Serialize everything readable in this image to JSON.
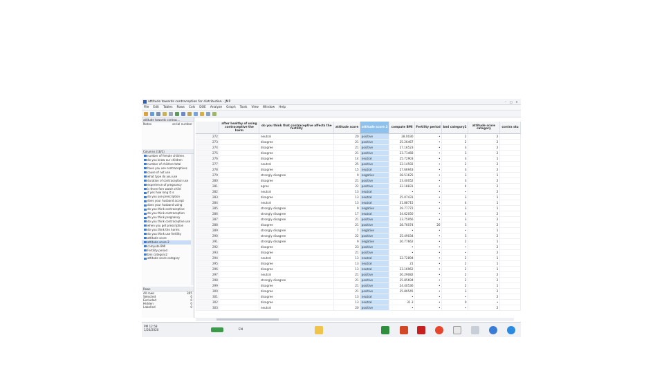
{
  "window": {
    "title": "attitude towards contraception for distribution - JMP"
  },
  "menu": [
    "File",
    "Edit",
    "Tables",
    "Rows",
    "Cols",
    "DOE",
    "Analyze",
    "Graph",
    "Tools",
    "View",
    "Window",
    "Help"
  ],
  "table_pane": {
    "name": "attitude towards contrac...",
    "notes_label": "Notes",
    "notes_value": "serial number"
  },
  "columns_pane": {
    "header": "Columns (18/1)",
    "items": [
      "number of female children",
      "do you know our children",
      "number of children total",
      "have you use contraceptives",
      "cause of not use",
      "what type do you use",
      "duration of contraception use",
      "experience of pregnancy",
      "is there fore watch child",
      "if yes how long it is",
      "do you use prescription",
      "does your husband accept",
      "does your husband using",
      "do you think contraceptive",
      "do you think contraception",
      "do you think pregnancy",
      "do you think contraceptive use",
      "when you get prescription",
      "do you think the harms",
      "do you think use fertility",
      "attitude score",
      "attitude score 2",
      "compute BMI",
      "Fertility period",
      "bmi category2",
      "attitude score category"
    ],
    "selected_index": 21
  },
  "rows_pane": {
    "header": "Rows",
    "stats": [
      {
        "label": "All rows",
        "value": "305"
      },
      {
        "label": "Selected",
        "value": "0"
      },
      {
        "label": "Excluded",
        "value": "0"
      },
      {
        "label": "Hidden",
        "value": "0"
      },
      {
        "label": "Labelled",
        "value": "0"
      }
    ]
  },
  "grid": {
    "headers": [
      "",
      "after healthy of using contraceptive the harm",
      "do you think that contraceptive affects the fertility",
      "attitude score",
      "attitude score 2",
      "compute BMI",
      "Fertility period",
      "bmi category2",
      "attitude score category",
      "contra stu"
    ],
    "rows": [
      [
        "272",
        "",
        "neutral",
        "20",
        "positive",
        "28.0030",
        "•",
        "2",
        "2",
        ""
      ],
      [
        "273",
        "",
        "disagree",
        "21",
        "positive",
        "25.26467",
        "•",
        "2",
        "2",
        ""
      ],
      [
        "274",
        "",
        "disagree",
        "21",
        "positive",
        "27.16523",
        "•",
        "3",
        "2",
        ""
      ],
      [
        "275",
        "",
        "disagree",
        "21",
        "positive",
        "23.71468",
        "•",
        "3",
        "2",
        ""
      ],
      [
        "276",
        "",
        "disagree",
        "14",
        "neutral",
        "25.72903",
        "•",
        "3",
        "1",
        ""
      ],
      [
        "277",
        "",
        "neutral",
        "25",
        "positive",
        "22.14592",
        "•",
        "2",
        "2",
        ""
      ],
      [
        "278",
        "",
        "disagree",
        "15",
        "neutral",
        "27.66943",
        "•",
        "3",
        "2",
        ""
      ],
      [
        "279",
        "",
        "strongly disagree",
        "9",
        "negative",
        "28.51625",
        "•",
        "3",
        "1",
        ""
      ],
      [
        "280",
        "",
        "disagree",
        "21",
        "positive",
        "23.40052",
        "•",
        "3",
        "2",
        ""
      ],
      [
        "281",
        "",
        "agree",
        "22",
        "positive",
        "32.18831",
        "•",
        "4",
        "2",
        ""
      ],
      [
        "282",
        "",
        "neutral",
        "13",
        "neutral",
        "•",
        "•",
        "•",
        "2",
        ""
      ],
      [
        "283",
        "",
        "disagree",
        "13",
        "neutral",
        "25.07431",
        "•",
        "3",
        "1",
        ""
      ],
      [
        "284",
        "",
        "neutral",
        "13",
        "neutral",
        "31.88715",
        "•",
        "4",
        "1",
        ""
      ],
      [
        "285",
        "",
        "strongly disagree",
        "9",
        "negative",
        "29.77772",
        "•",
        "3",
        "1",
        ""
      ],
      [
        "286",
        "",
        "strongly disagree",
        "17",
        "neutral",
        "34.62050",
        "•",
        "4",
        "2",
        ""
      ],
      [
        "287",
        "",
        "strongly disagree",
        "21",
        "positive",
        "23.75956",
        "•",
        "3",
        "2",
        ""
      ],
      [
        "288",
        "",
        "disagree",
        "21",
        "positive",
        "28.76074",
        "26",
        "3",
        "2",
        ""
      ],
      [
        "289",
        "",
        "strongly disagree",
        "7",
        "negative",
        "•",
        "•",
        "•",
        "1",
        ""
      ],
      [
        "290",
        "",
        "strongly disagree",
        "22",
        "positive",
        "25.49034",
        "•",
        "3",
        "2",
        ""
      ],
      [
        "291",
        "",
        "strongly disagree",
        "9",
        "negative",
        "20.77662",
        "•",
        "2",
        "1",
        ""
      ],
      [
        "292",
        "",
        "disagree",
        "23",
        "positive",
        "•",
        "•",
        "•",
        "2",
        ""
      ],
      [
        "293",
        "",
        "disagree",
        "21",
        "positive",
        "•",
        "•",
        "•",
        "2",
        ""
      ],
      [
        "294",
        "",
        "neutral",
        "13",
        "neutral",
        "22.72894",
        "•",
        "2",
        "1",
        ""
      ],
      [
        "295",
        "",
        "disagree",
        "13",
        "neutral",
        "21",
        "•",
        "2",
        "1",
        ""
      ],
      [
        "296",
        "",
        "disagree",
        "13",
        "neutral",
        "23.16962",
        "•",
        "2",
        "1",
        ""
      ],
      [
        "297",
        "",
        "neutral",
        "21",
        "positive",
        "20.29082",
        "•",
        "2",
        "2",
        ""
      ],
      [
        "298",
        "",
        "strongly disagree",
        "21",
        "positive",
        "25.85694",
        "•",
        "2",
        "2",
        ""
      ],
      [
        "299",
        "",
        "disagree",
        "21",
        "positive",
        "24.40536",
        "•",
        "2",
        "1",
        ""
      ],
      [
        "300",
        "",
        "disagree",
        "21",
        "positive",
        "25.89545",
        "•",
        "3",
        "2",
        ""
      ],
      [
        "301",
        "",
        "disagree",
        "13",
        "neutral",
        "•",
        "•",
        "•",
        "2",
        ""
      ],
      [
        "302",
        "",
        "disagree",
        "13",
        "neutral",
        "31.3",
        "•",
        "0",
        "•",
        ""
      ],
      [
        "303",
        "",
        "neutral",
        "20",
        "positive",
        "•",
        "•",
        "•",
        "2",
        ""
      ]
    ]
  },
  "taskbar": {
    "time": "PM 12:58",
    "date": "1/26/2020",
    "lang": "EN"
  },
  "colors": {
    "accent": "#3a7bd5",
    "selected_col": "#8ec1ec",
    "selected_cells": "#c7e0f7"
  }
}
